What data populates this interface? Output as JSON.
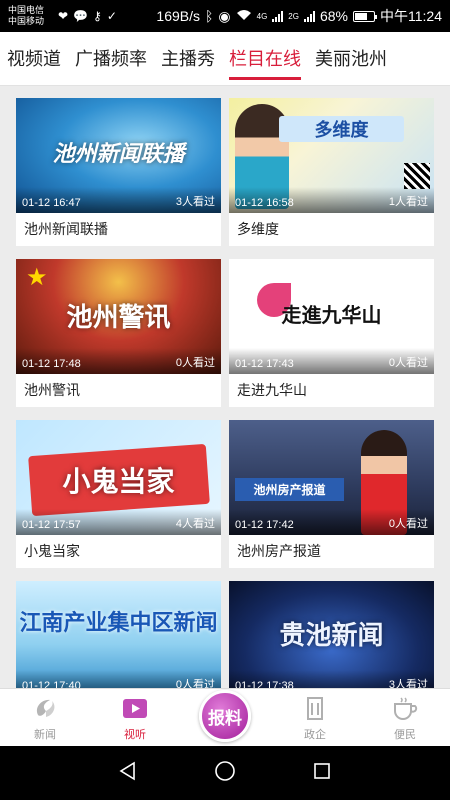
{
  "status_bar": {
    "carrier_1": "中国电信",
    "carrier_2": "中国移动",
    "speed": "169B/s",
    "net_4g": "4G",
    "net_2g": "2G",
    "battery": "68%",
    "battery_level": 0.68,
    "time": "中午11:24"
  },
  "tabs": [
    {
      "label": "视频道",
      "active": false
    },
    {
      "label": "广播频率",
      "active": false
    },
    {
      "label": "主播秀",
      "active": false
    },
    {
      "label": "栏目在线",
      "active": true
    },
    {
      "label": "美丽池州",
      "active": false
    }
  ],
  "programs": [
    {
      "title": "池州新闻联播",
      "time": "01-12 16:47",
      "views": "3人看过",
      "logo": "池州新闻联播"
    },
    {
      "title": "多维度",
      "time": "01-12 16:58",
      "views": "1人看过",
      "logo": "多维度"
    },
    {
      "title": "池州警讯",
      "time": "01-12 17:48",
      "views": "0人看过",
      "logo": "池州警讯"
    },
    {
      "title": "走进九华山",
      "time": "01-12 17:43",
      "views": "0人看过",
      "logo": "走進九华山"
    },
    {
      "title": "小鬼当家",
      "time": "01-12 17:57",
      "views": "4人看过",
      "logo": "小鬼当家"
    },
    {
      "title": "池州房产报道",
      "time": "01-12 17:42",
      "views": "0人看过",
      "logo": "池州房产报道"
    },
    {
      "title": "",
      "time": "01-12 17:40",
      "views": "0人看过",
      "logo": "江南产业集中区新闻"
    },
    {
      "title": "",
      "time": "01-12 17:38",
      "views": "3人看过",
      "logo": "贵池新闻"
    }
  ],
  "bottom_nav": [
    {
      "label": "新闻",
      "icon": "news-icon",
      "active": false
    },
    {
      "label": "视听",
      "icon": "video-icon",
      "active": true
    },
    {
      "label": "报料",
      "icon": "report-icon",
      "active": false
    },
    {
      "label": "政企",
      "icon": "building-icon",
      "active": false
    },
    {
      "label": "便民",
      "icon": "cup-icon",
      "active": false
    }
  ],
  "colors": {
    "accent": "#d81e3b",
    "report_button": "#b52aa9"
  }
}
